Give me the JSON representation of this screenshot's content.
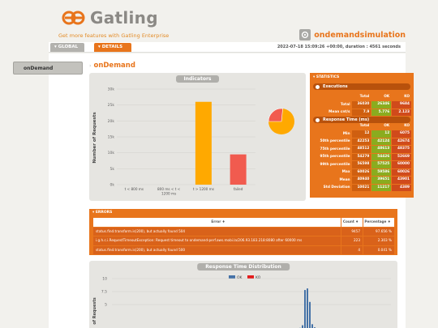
{
  "brand": {
    "name": "Gatling",
    "enterprise_link": "Get more features with Gatling Enterprise"
  },
  "simulation": {
    "name": "ondemandsimulation"
  },
  "tabs": [
    {
      "label": "GLOBAL"
    },
    {
      "label": "DETAILS"
    }
  ],
  "run_info": "2022-07-18 15:09:26 +00:00, duration : 4561 seconds",
  "sidebar": {
    "items": [
      {
        "label": "onDemand"
      }
    ]
  },
  "section_title": "onDemand",
  "indicators": {
    "title": "Indicators",
    "chart_data": {
      "type": "bar",
      "categories": [
        "t < 800 ms",
        "800 ms < t < 1200 ms",
        "t > 1200 ms",
        "failed"
      ],
      "values": [
        0,
        0,
        26000,
        9500
      ],
      "ylabel": "Number of Requests",
      "ylim": [
        0,
        30000
      ],
      "yticks": [
        "0k",
        "5k",
        "10k",
        "15k",
        "20k",
        "25k",
        "30k"
      ],
      "colors": [
        "#68b65c",
        "#ffdd00",
        "#ffa900",
        "#f15b4f"
      ]
    },
    "pie": {
      "ok_pct": 73.4,
      "ko_pct": 26.6,
      "ok_color": "#ffa900",
      "ko_color": "#f15b4f"
    }
  },
  "statistics": {
    "header": "STATISTICS",
    "executions_label": "Executions",
    "columns": [
      "Total",
      "OK",
      "KO"
    ],
    "executions": [
      {
        "label": "Total",
        "total": "36030",
        "ok": "26346",
        "ko": "9684"
      },
      {
        "label": "Mean cnt/s",
        "total": "7.9",
        "ok": "5.776",
        "ko": "2.123"
      }
    ],
    "response_time_label": "Response Time (ms)",
    "response_time": [
      {
        "label": "Min",
        "total": "12",
        "ok": "12",
        "ko": "6075"
      },
      {
        "label": "50th percentile",
        "total": "42253",
        "ok": "42124",
        "ko": "42674"
      },
      {
        "label": "75th percentile",
        "total": "48512",
        "ok": "48613",
        "ko": "48375"
      },
      {
        "label": "95th percentile",
        "total": "54279",
        "ok": "54426",
        "ko": "52669"
      },
      {
        "label": "99th percentile",
        "total": "56598",
        "ok": "57525",
        "ko": "60000"
      },
      {
        "label": "Max",
        "total": "60026",
        "ok": "59586",
        "ko": "60026"
      },
      {
        "label": "Mean",
        "total": "40940",
        "ok": "39651",
        "ko": "43901"
      },
      {
        "label": "Std Deviation",
        "total": "10021",
        "ok": "11217",
        "ko": "4389"
      }
    ]
  },
  "errors": {
    "header": "ERRORS",
    "columns": [
      "Error ♦",
      "Count ♦",
      "Percentage ♦"
    ],
    "rows": [
      {
        "message": "status.find.transform.is(200), but actually found 504",
        "count": "9457",
        "pct": "97.656 %"
      },
      {
        "message": "i.g.h.c.i.RequestTimeoutException: Request timeout to ondemand-perf.aws.mobi.la/206.93.183.218:8080 after 60000 ms",
        "count": "223",
        "pct": "2.303 %"
      },
      {
        "message": "status.find.transform.is(200), but actually found 500",
        "count": "4",
        "pct": "0.041 %"
      }
    ]
  },
  "distribution": {
    "title": "Response Time Distribution",
    "legend": [
      "OK",
      "KO"
    ],
    "colors": {
      "ok": "#4572a7",
      "ko": "#e31b1b"
    },
    "y_axis_label": "of Requests",
    "y_ticks": [
      "10",
      "7.5",
      "5"
    ],
    "bars": [
      0.3,
      0.5,
      1.0,
      7.8,
      8.1,
      5.5,
      1.2,
      0.6
    ]
  }
}
